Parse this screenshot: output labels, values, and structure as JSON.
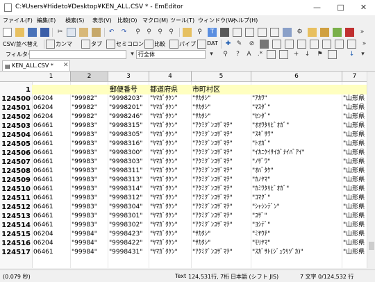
{
  "window": {
    "title": "C:¥Users¥Hideto¥Desktop¥KEN_ALL.CSV * - EmEditor"
  },
  "menu": [
    "ファイル(F)",
    "編集(E)",
    "検索(S)",
    "表示(V)",
    "比較(O)",
    "マクロ(M)",
    "ツール(T)",
    "ウィンドウ(W)",
    "ヘルプ(H)"
  ],
  "csv_toolbar": {
    "sort": "CSV/並べ替え",
    "comma": "カンマ",
    "tab": "タブ",
    "semicolon": "セミコロン",
    "compare": "比較",
    "pipe": "パイプ",
    "dat": "DAT"
  },
  "filter_bar": {
    "label": "フィルター",
    "scope": "行全体"
  },
  "tab": {
    "label": "KEN_ALL.CSV *"
  },
  "ruler": [
    "1",
    "2",
    "3",
    "4",
    "5",
    "6",
    "7"
  ],
  "header_row": {
    "line": "1",
    "c2": "郵便番号",
    "c3": "都道府県",
    "c4": "市町村区"
  },
  "rows": [
    {
      "line": "124500",
      "c1": "06204",
      "c2": "\"99982\"",
      "c3": "\"9998203\"",
      "c4": "\"ﾔﾏｶﾞﾀｹﾝ\"",
      "c5": "\"ｻｶﾀｼ\"",
      "c6": "\"ｱｶﾜ\"",
      "c7": "\"山形県"
    },
    {
      "line": "124501",
      "c1": "06204",
      "c2": "\"99982\"",
      "c3": "\"9998201\"",
      "c4": "\"ﾔﾏｶﾞﾀｹﾝ\"",
      "c5": "\"ｻｶﾀｼ\"",
      "c6": "\"ﾏｽﾀﾞ\"",
      "c7": "\"山形県"
    },
    {
      "line": "124502",
      "c1": "06204",
      "c2": "\"99982\"",
      "c3": "\"9998246\"",
      "c4": "\"ﾔﾏｶﾞﾀｹﾝ\"",
      "c5": "\"ｻｶﾀｼ\"",
      "c6": "\"ｾﾝﾀﾞ\"",
      "c7": "\"山形県"
    },
    {
      "line": "124503",
      "c1": "06461",
      "c2": "\"99983\"",
      "c3": "\"9998315\"",
      "c4": "\"ﾔﾏｶﾞﾀｹﾝ\"",
      "c5": "\"ｱｸﾐｸﾞﾝﾕｻﾞﾏﾁ\"",
      "c6": "\"ｵｵﾜﾀﾘﾋﾞｵｶﾞ\"",
      "c7": "\"山形県"
    },
    {
      "line": "124504",
      "c1": "06461",
      "c2": "\"99983\"",
      "c3": "\"9998305\"",
      "c4": "\"ﾔﾏｶﾞﾀｹﾝ\"",
      "c5": "\"ｱｸﾐｸﾞﾝﾕｻﾞﾏﾁ\"",
      "c6": "\"ｽｷﾞｻﾜ\"",
      "c7": "\"山形県"
    },
    {
      "line": "124505",
      "c1": "06461",
      "c2": "\"99983\"",
      "c3": "\"9998316\"",
      "c4": "\"ﾔﾏｶﾞﾀｹﾝ\"",
      "c5": "\"ｱｸﾐｸﾞﾝﾕｻﾞﾏﾁ\"",
      "c6": "\"ﾄｵｶﾞ\"",
      "c7": "\"山形県"
    },
    {
      "line": "124506",
      "c1": "06461",
      "c2": "\"99983\"",
      "c3": "\"9998300\"",
      "c4": "\"ﾔﾏｶﾞﾀｹﾝ\"",
      "c5": "\"ｱｸﾐｸﾞﾝﾕｻﾞﾏﾁ\"",
      "c6": "\"ｲｶﾆｹｲｻｲｶﾞﾅｲﾊﾞｱｲ\"",
      "c7": "\"山形県"
    },
    {
      "line": "124507",
      "c1": "06461",
      "c2": "\"99983\"",
      "c3": "\"9998303\"",
      "c4": "\"ﾔﾏｶﾞﾀｹﾝ\"",
      "c5": "\"ｱｸﾐｸﾞﾝﾕｻﾞﾏﾁ\"",
      "c6": "\"ﾉｻﾞﾜ\"",
      "c7": "\"山形県"
    },
    {
      "line": "124508",
      "c1": "06461",
      "c2": "\"99983\"",
      "c3": "\"9998311\"",
      "c4": "\"ﾔﾏｶﾞﾀｹﾝ\"",
      "c5": "\"ｱｸﾐｸﾞﾝﾕｻﾞﾏﾁ\"",
      "c6": "\"ｵﾊﾞﾀｹ\"",
      "c7": "\"山形県"
    },
    {
      "line": "124509",
      "c1": "06461",
      "c2": "\"99983\"",
      "c3": "\"9998313\"",
      "c4": "\"ﾔﾏｶﾞﾀｹﾝ\"",
      "c5": "\"ｱｸﾐｸﾞﾝﾕｻﾞﾏﾁ\"",
      "c6": "\"ｶﾉﾔﾏ\"",
      "c7": "\"山形県"
    },
    {
      "line": "124510",
      "c1": "06461",
      "c2": "\"99983\"",
      "c3": "\"9998314\"",
      "c4": "\"ﾔﾏｶﾞﾀｹﾝ\"",
      "c5": "\"ｱｸﾐｸﾞﾝﾕｻﾞﾏﾁ\"",
      "c6": "\"ｶﾐﾜﾀﾘﾋﾞｵｶﾞ\"",
      "c7": "\"山形県"
    },
    {
      "line": "124511",
      "c1": "06461",
      "c2": "\"99983\"",
      "c3": "\"9998312\"",
      "c4": "\"ﾔﾏｶﾞﾀｹﾝ\"",
      "c5": "\"ｱｸﾐｸﾞﾝﾕｻﾞﾏﾁ\"",
      "c6": "\"ｺﾏｸﾞ\"",
      "c7": "\"山形県"
    },
    {
      "line": "124512",
      "c1": "06461",
      "c2": "\"99983\"",
      "c3": "\"9998304\"",
      "c4": "\"ﾔﾏｶﾞﾀｹﾝ\"",
      "c5": "\"ｱｸﾐｸﾞﾝﾕｻﾞﾏﾁ\"",
      "c6": "\"ｼｬｼﾝﾃﾞﾝ\"",
      "c7": "\"山形県"
    },
    {
      "line": "124513",
      "c1": "06461",
      "c2": "\"99983\"",
      "c3": "\"9998301\"",
      "c4": "\"ﾔﾏｶﾞﾀｹﾝ\"",
      "c5": "\"ｱｸﾐｸﾞﾝﾕｻﾞﾏﾁ\"",
      "c6": "\"ﾕｻﾞ\"",
      "c7": "\"山形県"
    },
    {
      "line": "124514",
      "c1": "06461",
      "c2": "\"99983\"",
      "c3": "\"9998302\"",
      "c4": "\"ﾔﾏｶﾞﾀｹﾝ\"",
      "c5": "\"ｱｸﾐｸﾞﾝﾕｻﾞﾏﾁ\"",
      "c6": "\"ﾖｼﾃﾞ\"",
      "c7": "\"山形県"
    },
    {
      "line": "124515",
      "c1": "06204",
      "c2": "\"99984\"",
      "c3": "\"9998423\"",
      "c4": "\"ﾔﾏｶﾞﾀｹﾝ\"",
      "c5": "\"ｻｶﾀｼ\"",
      "c6": "\"ﾐﾔｳﾁ\"",
      "c7": "\"山形県"
    },
    {
      "line": "124516",
      "c1": "06204",
      "c2": "\"99984\"",
      "c3": "\"9998422\"",
      "c4": "\"ﾔﾏｶﾞﾀｹﾝ\"",
      "c5": "\"ｻｶﾀｼ\"",
      "c6": "\"ﾓﾘﾔﾏ\"",
      "c7": "\"山形県"
    },
    {
      "line": "124517",
      "c1": "06461",
      "c2": "\"99984\"",
      "c3": "\"9998431\"",
      "c4": "\"ﾔﾏｶﾞﾀｹﾝ\"",
      "c5": "\"ｱｸﾐｸﾞﾝﾕｻﾞﾏﾁ\"",
      "c6": "\"ｽｶﾞｻﾄ(ｼﾞｭｳﾘﾂﾞｶ)\"",
      "c7": "\"山形県"
    }
  ],
  "status": {
    "time": "(0.079 秒)",
    "mode": "Text",
    "lines": "124,531行, 7桁",
    "encoding": "日本語 (シフト JIS)",
    "chars": "7 文字",
    "position": "0/124,532 行"
  }
}
